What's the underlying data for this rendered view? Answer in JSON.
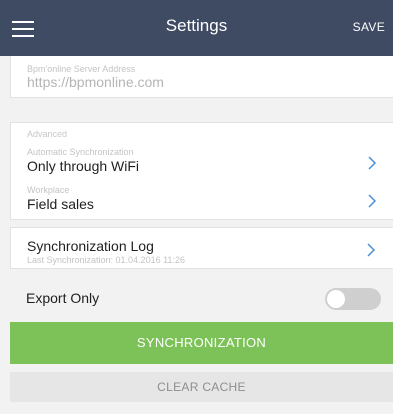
{
  "header": {
    "title": "Settings",
    "save_label": "SAVE",
    "menu_icon": "hamburger-menu-icon",
    "background": "#3f4a63"
  },
  "server": {
    "label": "Bpm'online Server Address",
    "value": "https://bpmonline.com"
  },
  "advanced": {
    "section_label": "Advanced",
    "sync": {
      "label": "Automatic Synchronization",
      "value": "Only through WiFi"
    },
    "workplace": {
      "label": "Workplace",
      "value": "Field sales"
    }
  },
  "sync_log": {
    "title": "Synchronization Log",
    "subtitle": "Last Synchronization: 01.04.2016 11:26"
  },
  "export_only": {
    "label": "Export Only",
    "enabled": false
  },
  "buttons": {
    "synchronization": "SYNCHRONIZATION",
    "clear_cache": "CLEAR CACHE"
  },
  "colors": {
    "accent_green": "#7cc258",
    "chevron_blue": "#4a90d9",
    "toggle_off": "#cfcfcf"
  }
}
